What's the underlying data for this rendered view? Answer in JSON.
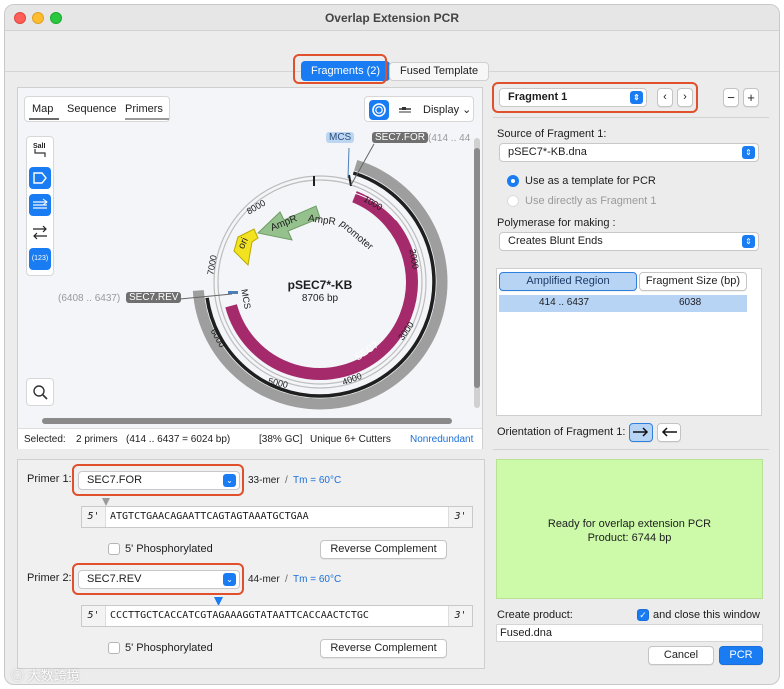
{
  "window": {
    "title": "Overlap Extension PCR"
  },
  "top_tabs": [
    {
      "label": "Fragments (2)"
    },
    {
      "label": "Fused Template"
    }
  ],
  "map_panel": {
    "view_tabs": [
      {
        "label": "Map"
      },
      {
        "label": "Sequence"
      },
      {
        "label": "Primers"
      }
    ],
    "display_label": "Display",
    "enzyme_label": "SalI",
    "numbers_label": "(123)",
    "plasmid_name": "pSEC7*-KB",
    "plasmid_size": "8706 bp",
    "features": {
      "mcs": "MCS",
      "sec7_for": "SEC7.FOR",
      "sec7_for_range": "(414 .. 44",
      "sec7_rev": "SEC7.REV",
      "sec7_rev_range": "(6408 .. 6437)",
      "ampr": "AmpR",
      "ampr_promoter": "AmpR promoter",
      "ori": "ori",
      "sec7": "SEC7",
      "mcs_inner": "MCS"
    },
    "ticks": [
      "1000",
      "2000",
      "3000",
      "4000",
      "5000",
      "6000",
      "7000",
      "8000"
    ],
    "status": {
      "selected_label": "Selected:",
      "selected_value": "2 primers",
      "range": "(414 .. 6437  =  6024 bp)",
      "gc": "[38% GC]",
      "cutters": "Unique 6+ Cutters",
      "nonredundant": "Nonredundant"
    }
  },
  "primer1": {
    "label": "Primer 1:",
    "value": "SEC7.FOR",
    "length": "33-mer",
    "tm": "Tm  =  60°C",
    "seq_5": "5'",
    "seq_3": "3'",
    "sequence": "ATGTCTGAACAGAATTCAGTAGTAAATGCTGAA",
    "phos_label": "5' Phosphorylated",
    "revcomp_label": "Reverse Complement"
  },
  "primer2": {
    "label": "Primer 2:",
    "value": "SEC7.REV",
    "length": "44-mer",
    "tm": "Tm  =  60°C",
    "seq_5": "5'",
    "seq_3": "3'",
    "sequence": "CCCTTGCTCACCATCGTAGAAAGGTATAATTCACCAACTCTGC",
    "phos_label": "5' Phosphorylated",
    "revcomp_label": "Reverse Complement"
  },
  "right": {
    "fragment_select": "Fragment 1",
    "source_label": "Source of Fragment 1:",
    "source_value": "pSEC7*-KB.dna",
    "radio_template": "Use as a template for PCR",
    "radio_direct": "Use directly as Fragment 1",
    "polymerase_label": "Polymerase for making :",
    "polymerase_value": "Creates Blunt Ends",
    "table_headers": [
      "Amplified Region",
      "Fragment Size (bp)"
    ],
    "table_rows": [
      {
        "region": "414  ..  6437",
        "size": "6038"
      }
    ],
    "orientation_label": "Orientation of Fragment 1:",
    "status_message": "Ready for overlap extension PCR",
    "status_product": "Product:  6744 bp",
    "create_label": "Create product:",
    "close_label": "and close this window",
    "product_name": "Fused.dna",
    "cancel_label": "Cancel",
    "pcr_label": "PCR"
  },
  "watermark": "大数跨境",
  "colors": {
    "accent": "#1a7cf2",
    "highlight_red": "#e0502c",
    "sec7": "#a52a6b",
    "ampr": "#8fb88a",
    "ori": "#f2e21f",
    "ready_bg": "#ccfaa9"
  }
}
